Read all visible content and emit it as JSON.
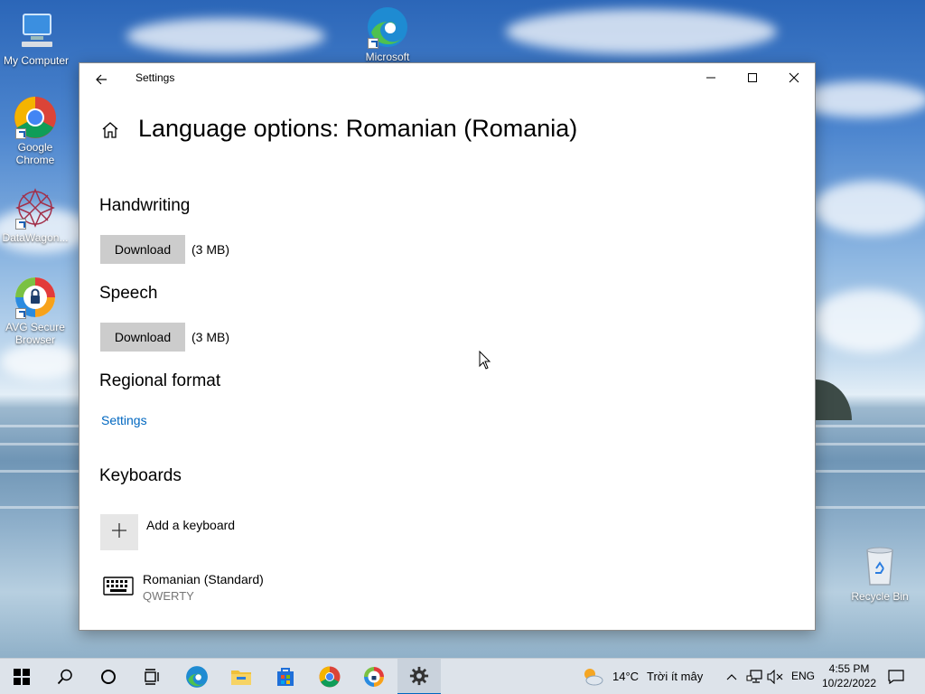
{
  "desktop": {
    "icons": [
      {
        "label": "My Computer"
      },
      {
        "label": "Google Chrome"
      },
      {
        "label": "DataWagon..."
      },
      {
        "label": "AVG Secure Browser"
      },
      {
        "label": "Microsoft"
      },
      {
        "label": "Recycle Bin"
      }
    ]
  },
  "window": {
    "title": "Settings",
    "back_icon": "back-arrow-icon",
    "controls": {
      "minimize": "minimize-icon",
      "maximize": "maximize-icon",
      "close": "close-icon"
    }
  },
  "page": {
    "home_icon": "home-icon",
    "title": "Language options: Romanian (Romania)"
  },
  "handwriting": {
    "heading": "Handwriting",
    "button": "Download",
    "size": "(3 MB)"
  },
  "speech": {
    "heading": "Speech",
    "button": "Download",
    "size": "(3 MB)"
  },
  "regional": {
    "heading": "Regional format",
    "link": "Settings"
  },
  "keyboards": {
    "heading": "Keyboards",
    "add_label": "Add a keyboard",
    "items": [
      {
        "name": "Romanian (Standard)",
        "layout": "QWERTY"
      }
    ]
  },
  "taskbar": {
    "apps": [
      "start-icon",
      "search-icon",
      "cortana-icon",
      "task-view-icon",
      "edge-icon",
      "file-explorer-icon",
      "store-icon",
      "chrome-icon",
      "avg-browser-icon",
      "settings-icon"
    ],
    "weather": {
      "temp": "14°C",
      "desc": "Trời ít mây"
    },
    "language": "ENG",
    "time": "4:55 PM",
    "date": "10/22/2022"
  },
  "colors": {
    "accent": "#0067c0",
    "button_bg": "#cccccc",
    "taskbar_bg": "#dde3ea"
  }
}
